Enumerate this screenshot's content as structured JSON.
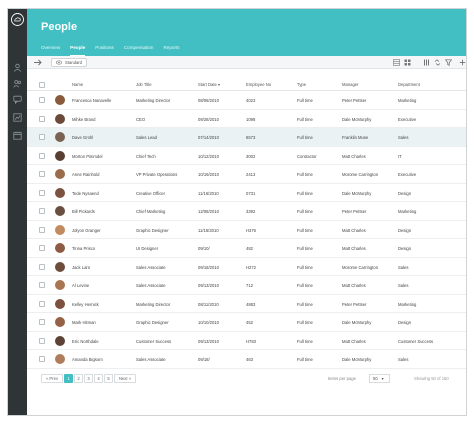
{
  "app": {
    "title": "People"
  },
  "tabs": [
    {
      "label": "Overview"
    },
    {
      "label": "People",
      "active": true
    },
    {
      "label": "Positions"
    },
    {
      "label": "Compensation"
    },
    {
      "label": "Reports"
    }
  ],
  "toolbar": {
    "view_label": "Standard"
  },
  "table": {
    "columns": [
      "Name",
      "Job Title",
      "Start Date",
      "Employee No",
      "Type",
      "Manager",
      "Department"
    ],
    "sort_indicator": "▾",
    "rows": [
      {
        "name": "Francesca Nanavelle",
        "job": "Marketing Director",
        "date": "08/08/2010",
        "emp": "4023",
        "type": "Full time",
        "manager": "Peter Pettser",
        "dept": "Marketing",
        "avatar": "#8a5a3c"
      },
      {
        "name": "Mihke Brand",
        "job": "CEO",
        "date": "09/28/2010",
        "emp": "1098",
        "type": "Full time",
        "manager": "Dale McMurphy",
        "dept": "Executive",
        "avatar": "#6b4a3a"
      },
      {
        "name": "Dave Grohl",
        "job": "Sales Lead",
        "date": "07/14/2010",
        "emp": "6573",
        "type": "Full time",
        "manager": "Franklin Muse",
        "dept": "Sales",
        "avatar": "#7a6252"
      },
      {
        "name": "Morton Pimmdel",
        "job": "Chief Tech",
        "date": "10/12/2010",
        "emp": "3002",
        "type": "Contractor",
        "manager": "Matt Charles",
        "dept": "IT",
        "avatar": "#5a4032"
      },
      {
        "name": "Anne Rainhold",
        "job": "VP Private Operations",
        "date": "10/19/2010",
        "emp": "2413",
        "type": "Full time",
        "manager": "Morome Carrington",
        "dept": "Executive",
        "avatar": "#9b6b4c"
      },
      {
        "name": "Tede Nysaend",
        "job": "Creative Officer",
        "date": "11/16/2010",
        "emp": "0731",
        "type": "Full time",
        "manager": "Dale McMurphy",
        "dept": "Design",
        "avatar": "#7b5240"
      },
      {
        "name": "Bill Pickards",
        "job": "Chief Marketing",
        "date": "12/08/2010",
        "emp": "3392",
        "type": "Full time",
        "manager": "Peter Pettser",
        "dept": "Marketing",
        "avatar": "#6a4e3f"
      },
      {
        "name": "Jolyon Granger",
        "job": "Graphic Designer",
        "date": "11/16/2010",
        "emp": "H376",
        "type": "Full time",
        "manager": "Matt Charles",
        "dept": "Design",
        "avatar": "#c28a5f"
      },
      {
        "name": "Tinna Prisco",
        "job": "UI Designer",
        "date": "09/10/",
        "emp": "482",
        "type": "Full time",
        "manager": "Matt Charles",
        "dept": "Design",
        "avatar": "#8e5c44"
      },
      {
        "name": "Jack Lars",
        "job": "Sales Associate",
        "date": "09/18/2010",
        "emp": "H272",
        "type": "Full time",
        "manager": "Morome Carrington",
        "dept": "Sales",
        "avatar": "#6d4c3b"
      },
      {
        "name": "Al Levine",
        "job": "Sales Associate",
        "date": "09/13/2010",
        "emp": "712",
        "type": "Full time",
        "manager": "Matt Charles",
        "dept": "Sales",
        "avatar": "#a87552"
      },
      {
        "name": "Kelley Hernick",
        "job": "Marketing Director",
        "date": "08/11/2010",
        "emp": "4883",
        "type": "Full time",
        "manager": "Peter Pettser",
        "dept": "Marketing",
        "avatar": "#7c513d"
      },
      {
        "name": "Mark Hitman",
        "job": "Graphic Designer",
        "date": "10/10/2010",
        "emp": "452",
        "type": "Full time",
        "manager": "Dale McMurphy",
        "dept": "Design",
        "avatar": "#956247"
      },
      {
        "name": "Eric Northdale",
        "job": "Customer Success",
        "date": "09/13/2010",
        "emp": "H783",
        "type": "Full time",
        "manager": "Matt Charles",
        "dept": "Customer Success",
        "avatar": "#5d4335"
      },
      {
        "name": "Amanda Bigsom",
        "job": "Sales Associate",
        "date": "09/18/",
        "emp": "463",
        "type": "Full time",
        "manager": "Dale McMurphy",
        "dept": "Sales",
        "avatar": "#b07d5c"
      }
    ]
  },
  "pagination": {
    "prev_label": "« Prev",
    "pages": [
      "1",
      "2",
      "3",
      "4",
      "5"
    ],
    "next_label": "Next »",
    "rows_per_page_label": "Items per page",
    "rows_per_page_value": "50",
    "showing_text": "Showing 50 of 150"
  },
  "colors": {
    "accent": "#41bfc2",
    "sidebar": "#2f3537",
    "highlight_row": "#eaf2f4"
  }
}
